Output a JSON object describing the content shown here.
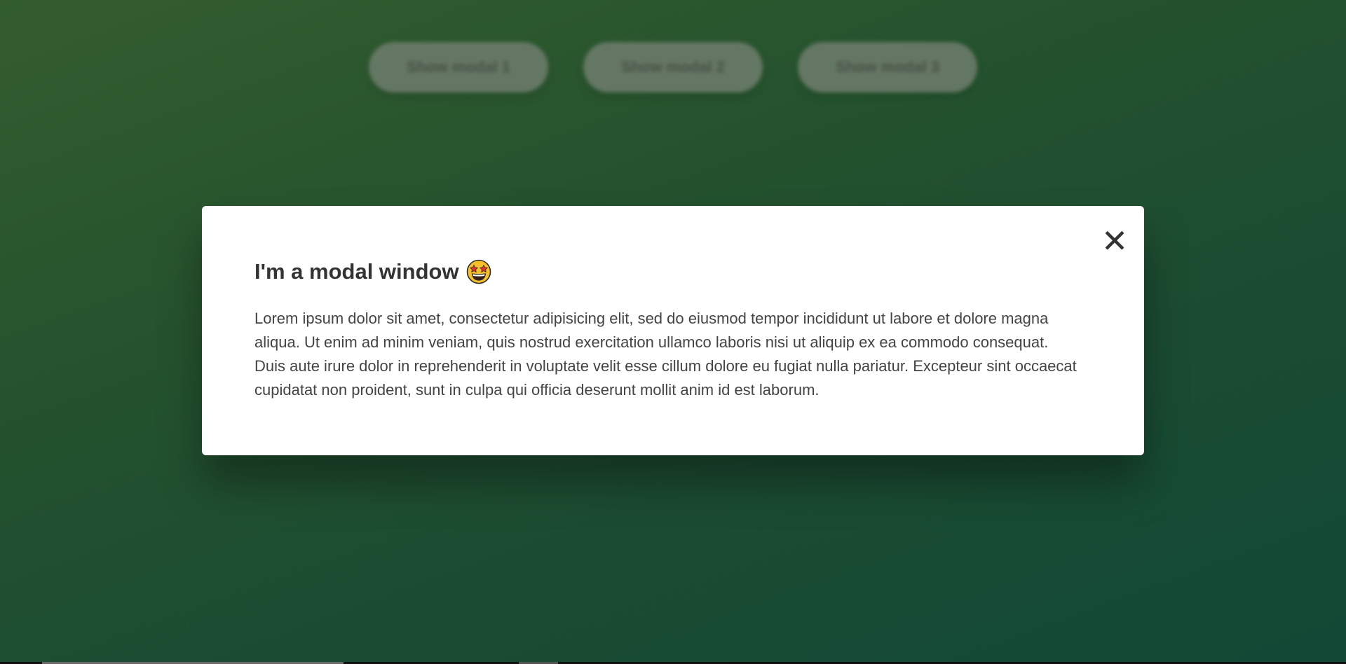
{
  "buttons": [
    {
      "label": "Show modal 1"
    },
    {
      "label": "Show modal 2"
    },
    {
      "label": "Show modal 3"
    }
  ],
  "modal": {
    "close_symbol": "✕",
    "title": "I'm a modal window",
    "title_emoji": "star-struck-emoji",
    "body": "Lorem ipsum dolor sit amet, consectetur adipisicing elit, sed do eiusmod tempor incididunt ut labore et dolore magna aliqua. Ut enim ad minim veniam, quis nostrud exercitation ullamco laboris nisi ut aliquip ex ea commodo consequat. Duis aute irure dolor in reprehenderit in voluptate velit esse cillum dolore eu fugiat nulla pariatur. Excepteur sint occaecat cupidatat non proident, sunt in culpa qui officia deserunt mollit anim id est laborum."
  },
  "colors": {
    "background_start": "#355f30",
    "background_end": "#124b38",
    "modal_bg": "#ffffff",
    "text": "#333333"
  }
}
